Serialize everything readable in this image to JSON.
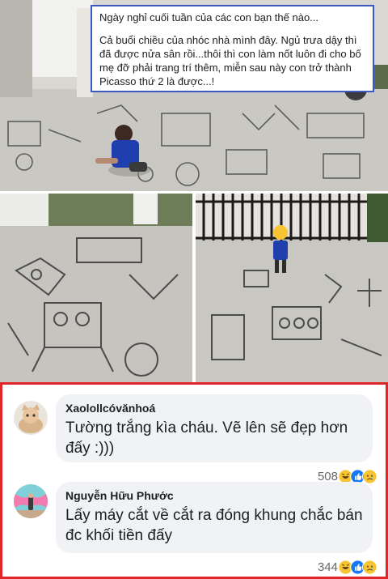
{
  "post": {
    "caption_line1": "Ngày nghỉ cuối tuần của các con bạn thế nào...",
    "caption_body": "Cả buổi chiều của nhóc nhà mình đây. Ngủ trưa dậy thì đã được nửa sân rồi...thôi thì con làm nốt luôn đi cho bố mẹ đỡ phải trang trí thêm, miễn sau này con trở thành Picasso thứ 2 là được...!"
  },
  "comments": [
    {
      "author": "Xaolollcóvănhoá",
      "text": "Tường trắng kìa cháu. Vẽ lên sẽ đẹp hơn đấy :)))",
      "reaction_count": "508",
      "reactions": [
        "haha-icon",
        "like-icon",
        "sad-icon"
      ]
    },
    {
      "author": "Nguyễn Hữu Phước",
      "text": "Lấy máy cắt về cắt ra đóng khung chắc bán đc khối tiền đấy",
      "reaction_count": "344",
      "reactions": [
        "haha-icon",
        "like-icon",
        "sad-icon"
      ]
    }
  ],
  "colors": {
    "caption_border": "#3a5bbd",
    "comments_border": "#e0262a",
    "bubble_bg": "#f0f2f5",
    "like_blue": "#1877f2",
    "haha_yellow": "#f7c531"
  }
}
